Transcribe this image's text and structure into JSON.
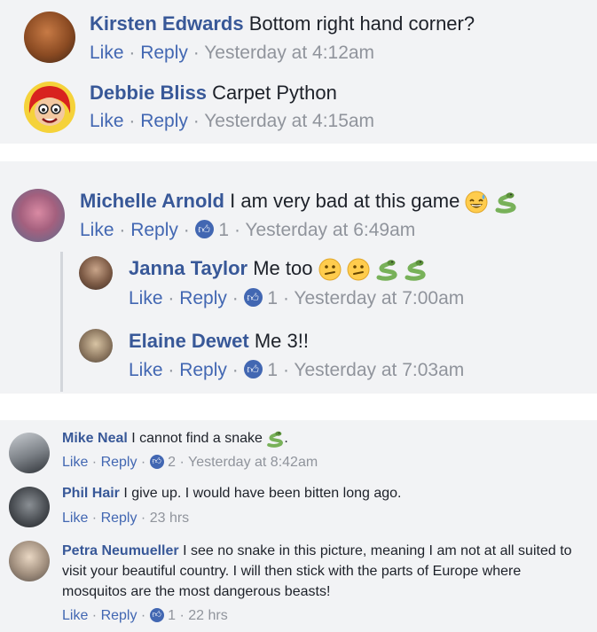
{
  "comments_top": [
    {
      "name": "Kirsten Edwards",
      "text": "Bottom right hand corner?",
      "like": "Like",
      "reply": "Reply",
      "time": "Yesterday at 4:12am"
    },
    {
      "name": "Debbie Bliss",
      "text": "Carpet Python",
      "like": "Like",
      "reply": "Reply",
      "time": "Yesterday at 4:15am"
    }
  ],
  "thread": {
    "name": "Michelle Arnold",
    "text": "I am very bad at this game",
    "like": "Like",
    "reply": "Reply",
    "likes": "1",
    "time": "Yesterday at 6:49am",
    "replies": [
      {
        "name": "Janna Taylor",
        "text": "Me too",
        "like": "Like",
        "reply": "Reply",
        "likes": "1",
        "time": "Yesterday at 7:00am"
      },
      {
        "name": "Elaine Dewet",
        "text": "Me 3!!",
        "like": "Like",
        "reply": "Reply",
        "likes": "1",
        "time": "Yesterday at 7:03am"
      }
    ]
  },
  "comments_bottom": [
    {
      "name": "Mike Neal",
      "text": "I cannot find a snake",
      "trail": ".",
      "like": "Like",
      "reply": "Reply",
      "likes": "2",
      "time": "Yesterday at 8:42am"
    },
    {
      "name": "Phil Hair",
      "text": "I give up. I would have been bitten long ago.",
      "like": "Like",
      "reply": "Reply",
      "time": "23 hrs"
    },
    {
      "name": "Petra Neumueller",
      "text": "I see no snake in this picture, meaning I am not at all suited to visit your beautiful country. I will then stick with the parts of Europe where mosquitos are the most dangerous beasts!",
      "like": "Like",
      "reply": "Reply",
      "likes": "1",
      "time": "22 hrs"
    }
  ],
  "colors": {
    "name": "#385898",
    "link": "#4267b2",
    "meta": "#90949c",
    "bg": "#f2f3f5"
  },
  "icons": [
    "thumbs-up-icon",
    "grinning-sweat-emoji",
    "snake-emoji",
    "confused-emoji"
  ]
}
